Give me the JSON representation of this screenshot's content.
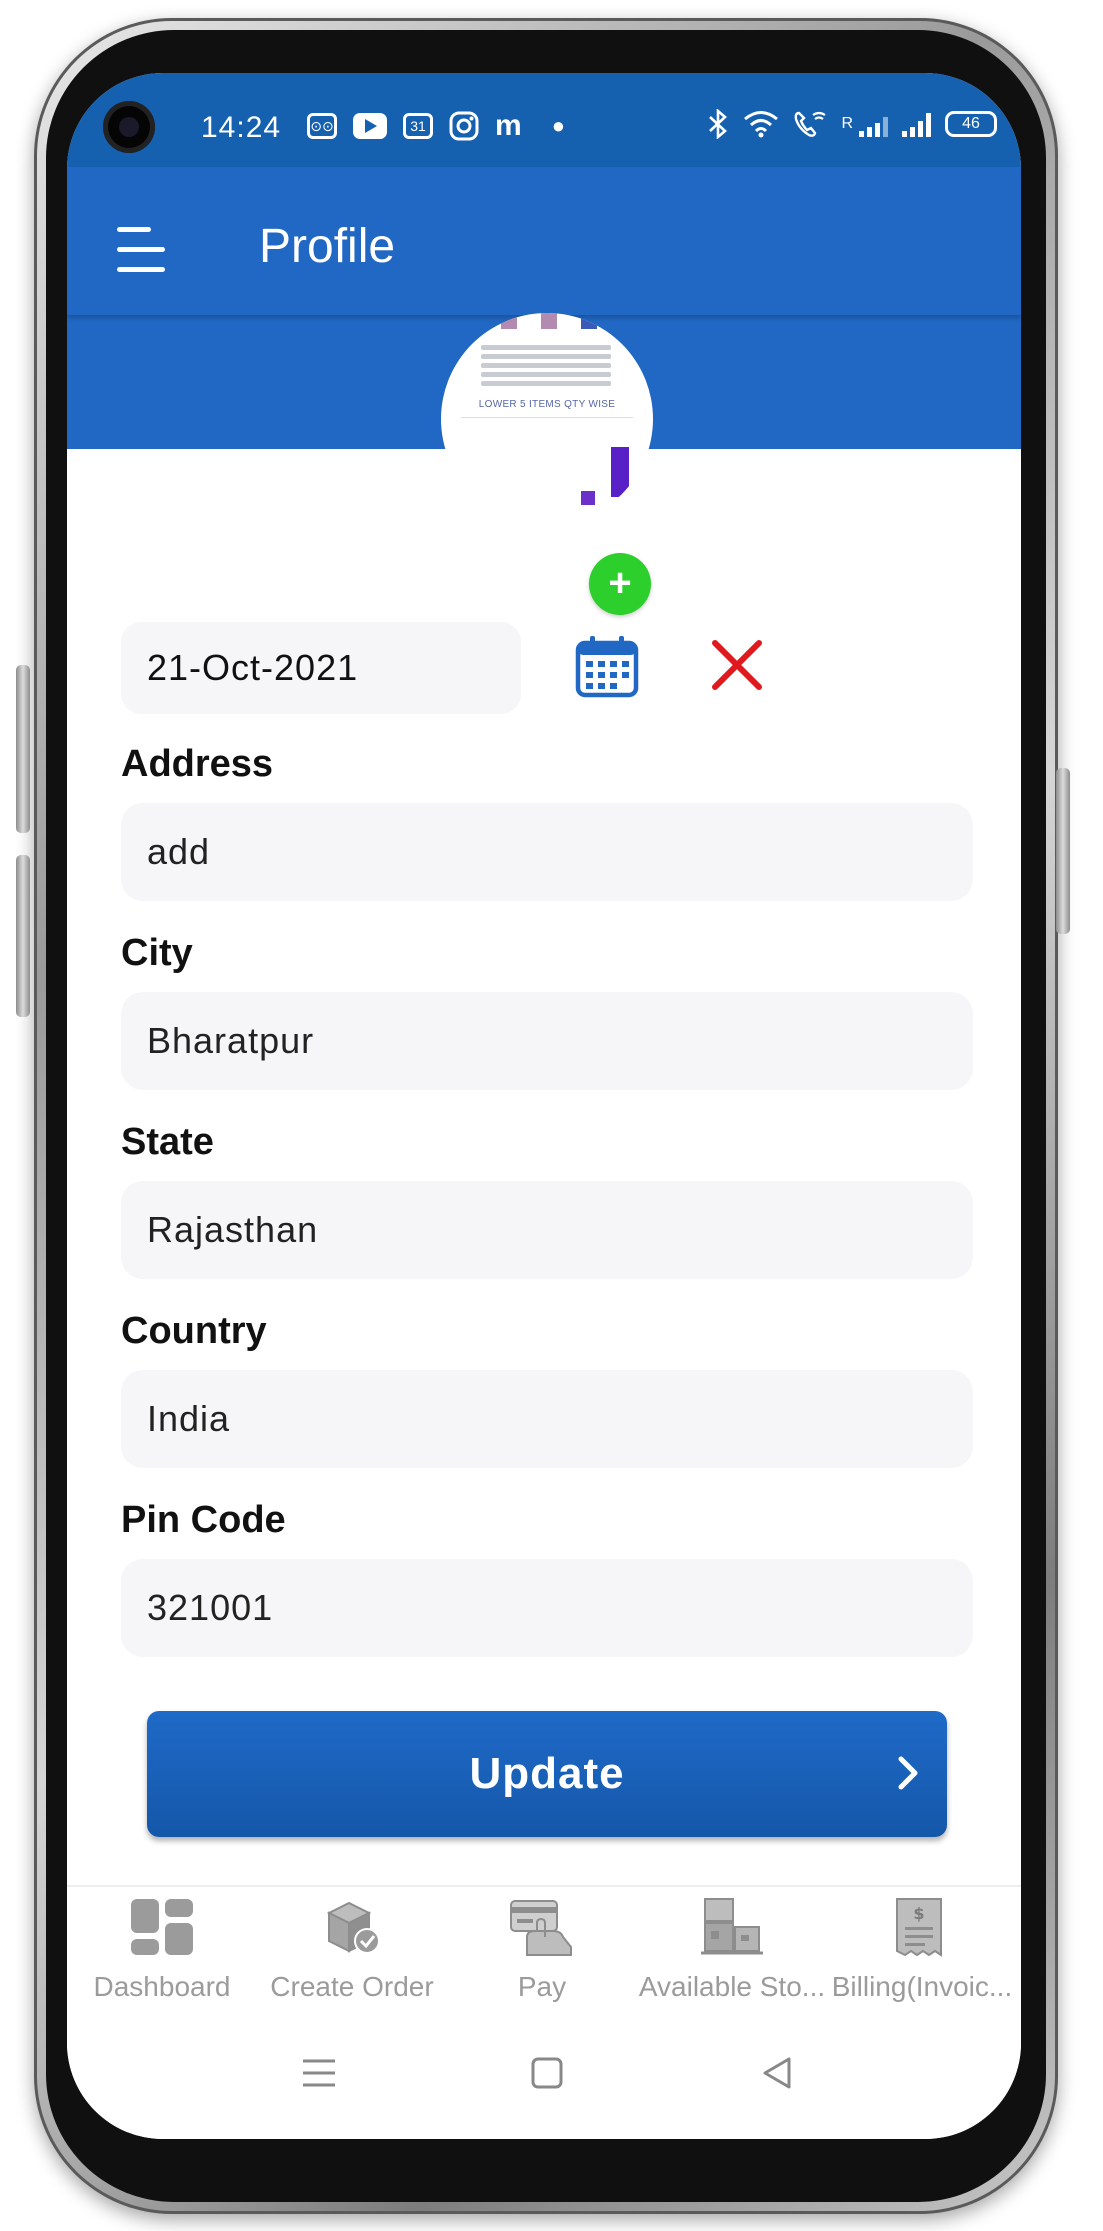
{
  "status_bar": {
    "time": "14:24",
    "notif_calendar": "31",
    "notif_m": "m",
    "signal_text": "R",
    "battery": "46"
  },
  "app_bar": {
    "title": "Profile"
  },
  "avatar": {
    "caption": "LOWER 5 ITEMS QTY WISE"
  },
  "form": {
    "date_value": "21-Oct-2021",
    "fields": [
      {
        "label": "Address",
        "value": "add"
      },
      {
        "label": "City",
        "value": "Bharatpur"
      },
      {
        "label": "State",
        "value": "Rajasthan"
      },
      {
        "label": "Country",
        "value": "India"
      },
      {
        "label": "Pin Code",
        "value": "321001"
      }
    ],
    "update_label": "Update"
  },
  "bottom_nav": {
    "items": [
      {
        "label": "Dashboard",
        "icon": "dashboard-icon"
      },
      {
        "label": "Create Order",
        "icon": "create-order-icon"
      },
      {
        "label": "Pay",
        "icon": "pay-icon"
      },
      {
        "label": "Available Sto...",
        "icon": "available-stock-icon"
      },
      {
        "label": "Billing(Invoic...",
        "icon": "billing-icon"
      }
    ]
  },
  "colors": {
    "primary": "#2168c4",
    "status_bar": "#1561b0",
    "add_photo": "#2ccf2c",
    "clear": "#e0191f",
    "nav_icon": "#9b9b9b"
  }
}
